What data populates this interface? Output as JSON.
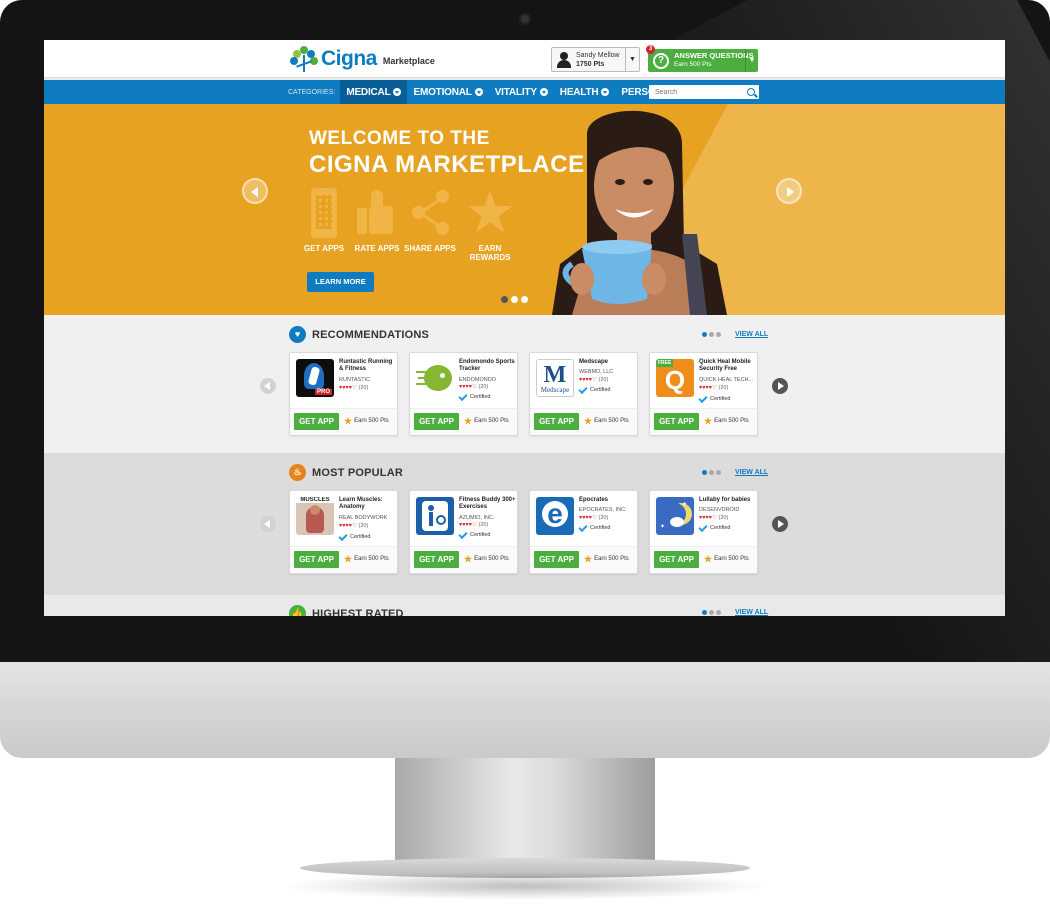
{
  "header": {
    "logo_text": "Cigna",
    "logo_sub": "Marketplace",
    "user_name": "Sandy Mellow",
    "user_points": "1750 Pts",
    "notification_count": "3",
    "answer_title": "ANSWER QUESTIONS",
    "answer_sub": "Earn 500 Pts"
  },
  "nav": {
    "categories_label": "CATEGORIES:",
    "items": [
      "MEDICAL",
      "EMOTIONAL",
      "VITALITY",
      "HEALTH",
      "PERSONAL"
    ],
    "active": "MEDICAL",
    "search_placeholder": "Search"
  },
  "hero": {
    "title_line1": "WELCOME TO THE",
    "title_line2": "CIGNA MARKETPLACE",
    "features": [
      "GET APPS",
      "RATE APPS",
      "SHARE APPS",
      "EARN REWARDS"
    ],
    "button": "LEARN MORE",
    "slide_dots": 3,
    "active_slide": 1
  },
  "sections": [
    {
      "title": "RECOMMENDATIONS",
      "icon": "heart-icon",
      "view_all": "VIEW ALL",
      "apps": [
        {
          "name": "Runtastic Running & Fitness",
          "developer": "RUNTASTIC",
          "reviews": "(20)",
          "certified": "",
          "cta": "GET APP",
          "earn": "Earn 500 Pts"
        },
        {
          "name": "Endomondo Sports Tracker",
          "developer": "ENDOMONDO",
          "reviews": "(20)",
          "certified": "Certified",
          "cta": "GET APP",
          "earn": "Earn 500 Pts"
        },
        {
          "name": "Medscape",
          "developer": "WEBMD, LLC",
          "reviews": "(20)",
          "certified": "Certified",
          "cta": "GET APP",
          "earn": "Earn 500 Pts"
        },
        {
          "name": "Quick Heal Mobile Security Free",
          "developer": "QUICK HEAL TECH...",
          "reviews": "(20)",
          "certified": "Certified",
          "cta": "GET APP",
          "earn": "Earn 500 Pts"
        }
      ]
    },
    {
      "title": "MOST POPULAR",
      "icon": "flame-icon",
      "view_all": "VIEW ALL",
      "apps": [
        {
          "name": "Learn Muscles: Anatomy",
          "developer": "REAL BODYWORK",
          "reviews": "(20)",
          "certified": "Certified",
          "cta": "GET APP",
          "earn": "Earn 500 Pts"
        },
        {
          "name": "Fitness Buddy 300+ Exercises",
          "developer": "AZUMIO, INC.",
          "reviews": "(20)",
          "certified": "Certified",
          "cta": "GET APP",
          "earn": "Earn 500 Pts"
        },
        {
          "name": "Epocrates",
          "developer": "EPOCRATES, INC.",
          "reviews": "(20)",
          "certified": "Certified",
          "cta": "GET APP",
          "earn": "Earn 500 Pts"
        },
        {
          "name": "Lullaby for babies",
          "developer": "DESENVDROID",
          "reviews": "(20)",
          "certified": "Certified",
          "cta": "GET APP",
          "earn": "Earn 500 Pts"
        }
      ]
    },
    {
      "title": "HIGHEST RATED",
      "icon": "thumbs-up-icon",
      "view_all": "VIEW ALL"
    }
  ],
  "thumb_labels": {
    "runtastic": "PRO",
    "medscape_m": "M",
    "medscape_word": "Medscape",
    "quickheal_badge": "FREE",
    "quickheal_q": "Q",
    "muscles": "MUSCLES",
    "epocrates": "e"
  },
  "colors": {
    "brand_blue": "#0f7cc2",
    "hero_orange": "#e8a221",
    "cta_green": "#4cae3f",
    "star_red": "#d1232a"
  }
}
